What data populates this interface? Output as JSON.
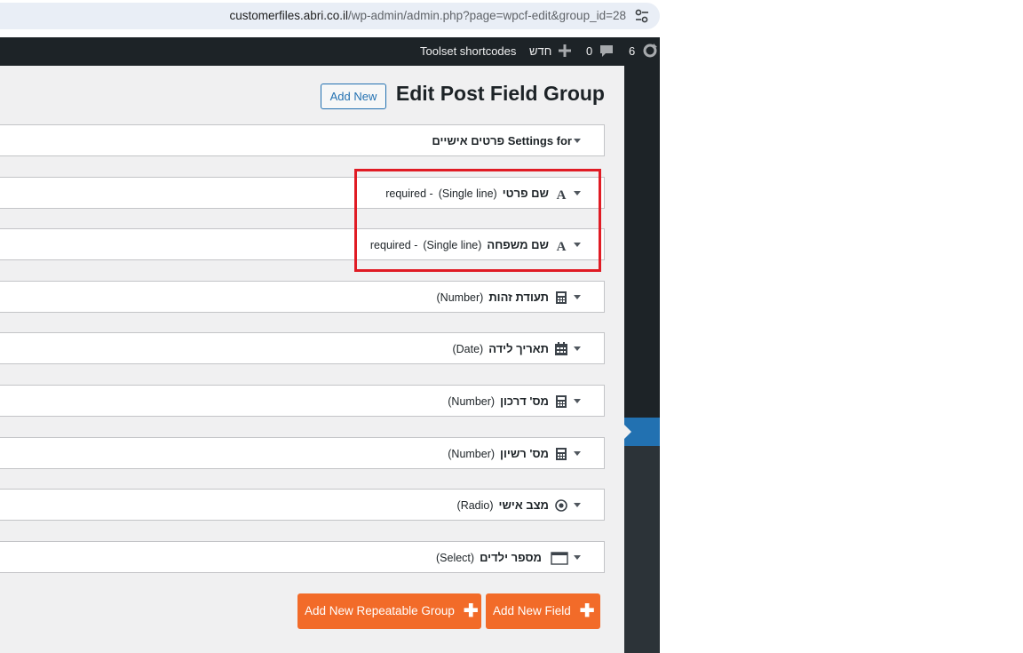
{
  "browser": {
    "url_host": "customerfiles.abri.co.il",
    "url_path": "/wp-admin/admin.php?page=wpcf-edit&group_id=28"
  },
  "adminbar": {
    "updates_count": "6",
    "comments_count": "0",
    "new_label": "חדש",
    "toolset_label": "Toolset shortcodes"
  },
  "page": {
    "title": "Edit Post Field Group",
    "add_new_label": "Add New"
  },
  "settings": {
    "label": "Settings for",
    "group_name": "פרטים אישיים"
  },
  "fields": [
    {
      "name": "שם פרטי",
      "type": "(Single line)",
      "extra": "required - ",
      "icon": "text-icon"
    },
    {
      "name": "שם משפחה",
      "type": "(Single line)",
      "extra": "required - ",
      "icon": "text-icon"
    },
    {
      "name": "תעודת זהות",
      "type": "(Number)",
      "extra": "",
      "icon": "calculator-icon"
    },
    {
      "name": "תאריך לידה",
      "type": "(Date)",
      "extra": "",
      "icon": "calendar-icon"
    },
    {
      "name": "מס' דרכון",
      "type": "(Number)",
      "extra": "",
      "icon": "calculator-icon"
    },
    {
      "name": "מס' רשיון",
      "type": "(Number)",
      "extra": "",
      "icon": "calculator-icon"
    },
    {
      "name": "מצב אישי",
      "type": "(Radio)",
      "extra": "",
      "icon": "radio-icon"
    },
    {
      "name": "מספר ילדים",
      "type": "(Select)",
      "extra": "",
      "icon": "select-icon"
    }
  ],
  "actions": {
    "add_repeatable_group": "Add New Repeatable Group",
    "add_field": "Add New Field"
  },
  "colors": {
    "accent_blue": "#2271b1",
    "button_orange": "#f26b29",
    "highlight_red": "#e01b24",
    "adminbar_bg": "#1d2327"
  }
}
